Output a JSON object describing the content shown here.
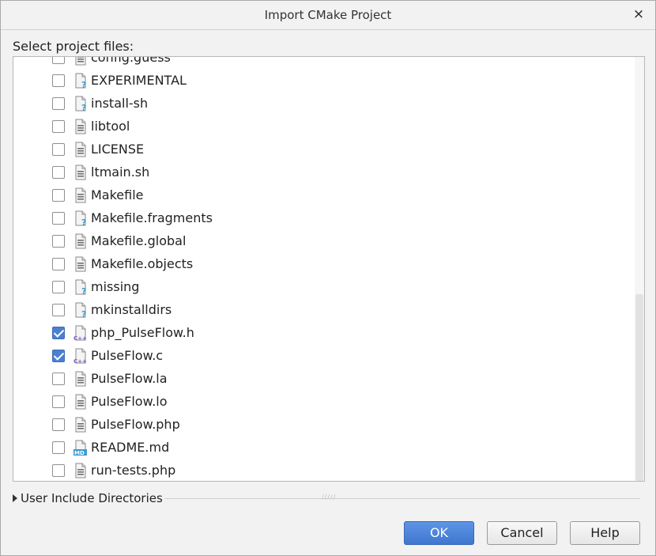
{
  "dialog": {
    "title": "Import CMake Project",
    "close_glyph": "×",
    "prompt": "Select project files:"
  },
  "files": [
    {
      "name": "config.guess",
      "checked": false,
      "icon": "text-file-icon"
    },
    {
      "name": "EXPERIMENTAL",
      "checked": false,
      "icon": "unknown-file-icon"
    },
    {
      "name": "install-sh",
      "checked": false,
      "icon": "unknown-file-icon"
    },
    {
      "name": "libtool",
      "checked": false,
      "icon": "text-file-icon"
    },
    {
      "name": "LICENSE",
      "checked": false,
      "icon": "text-file-icon"
    },
    {
      "name": "ltmain.sh",
      "checked": false,
      "icon": "text-file-icon"
    },
    {
      "name": "Makefile",
      "checked": false,
      "icon": "text-file-icon"
    },
    {
      "name": "Makefile.fragments",
      "checked": false,
      "icon": "unknown-file-icon"
    },
    {
      "name": "Makefile.global",
      "checked": false,
      "icon": "text-file-icon"
    },
    {
      "name": "Makefile.objects",
      "checked": false,
      "icon": "text-file-icon"
    },
    {
      "name": "missing",
      "checked": false,
      "icon": "unknown-file-icon"
    },
    {
      "name": "mkinstalldirs",
      "checked": false,
      "icon": "unknown-file-icon"
    },
    {
      "name": "php_PulseFlow.h",
      "checked": true,
      "icon": "cpp-file-icon"
    },
    {
      "name": "PulseFlow.c",
      "checked": true,
      "icon": "cpp-file-icon"
    },
    {
      "name": "PulseFlow.la",
      "checked": false,
      "icon": "text-file-icon"
    },
    {
      "name": "PulseFlow.lo",
      "checked": false,
      "icon": "text-file-icon"
    },
    {
      "name": "PulseFlow.php",
      "checked": false,
      "icon": "text-file-icon"
    },
    {
      "name": "README.md",
      "checked": false,
      "icon": "markdown-file-icon"
    },
    {
      "name": "run-tests.php",
      "checked": false,
      "icon": "text-file-icon"
    }
  ],
  "section": {
    "label": "User Include Directories",
    "expanded": false,
    "grip": "/////"
  },
  "buttons": {
    "ok": "OK",
    "cancel": "Cancel",
    "help": "Help"
  },
  "colors": {
    "accent": "#4a80d0",
    "cpp_badge": "#7b5cc7",
    "md_badge": "#3a9bd2",
    "unknown_badge": "#3a9bd2"
  }
}
